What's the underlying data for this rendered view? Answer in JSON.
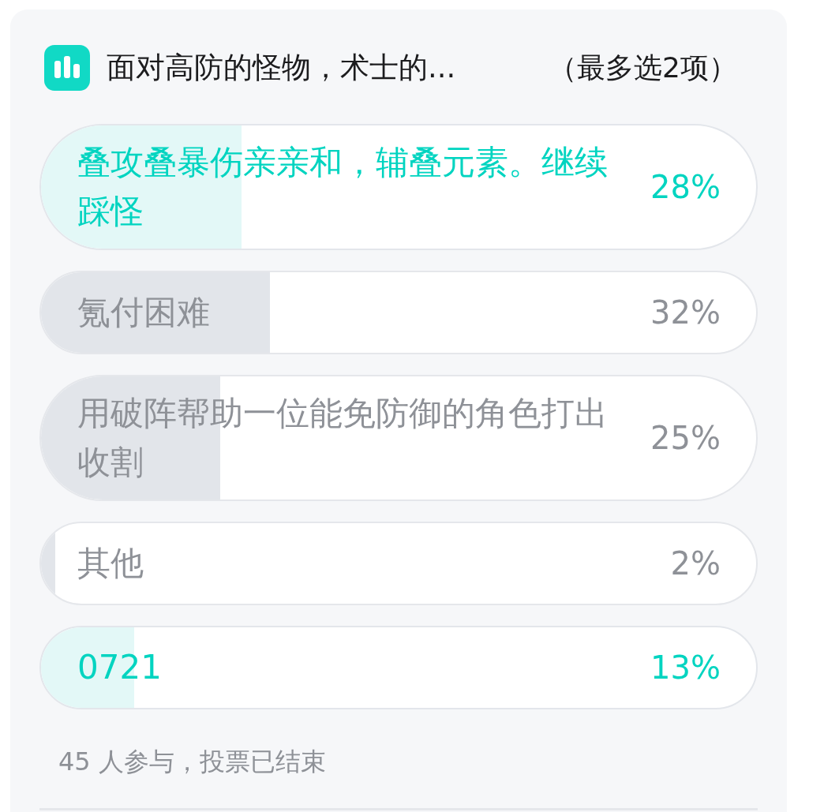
{
  "poll": {
    "title": "面对高防的怪物，术士的...",
    "limit": "（最多选2项）",
    "options": [
      {
        "label": "叠攻叠暴伤亲亲和，辅叠元素。继续踩怪",
        "percent": "28%",
        "level": 0.28,
        "selected": true
      },
      {
        "label": "氪付困难",
        "percent": "32%",
        "level": 0.32,
        "selected": false
      },
      {
        "label": "用破阵帮助一位能免防御的角色打出收割",
        "percent": "25%",
        "level": 0.25,
        "selected": false
      },
      {
        "label": "其他",
        "percent": "2%",
        "level": 0.02,
        "selected": false
      },
      {
        "label": "0721",
        "percent": "13%",
        "level": 0.13,
        "selected": true
      }
    ],
    "footer": "45 人参与，投票已结束"
  }
}
